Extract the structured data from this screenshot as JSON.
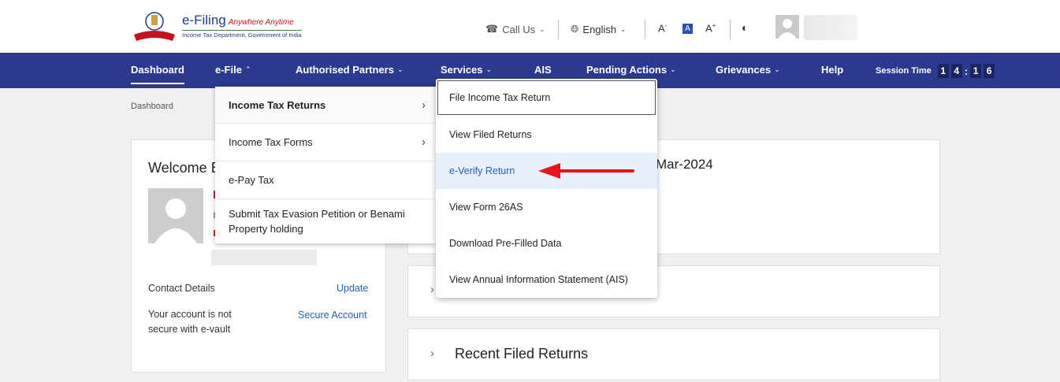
{
  "header": {
    "logo_title": "e-Filing",
    "logo_tagline": "Anywhere Anytime",
    "logo_subtitle": "Income Tax Department, Government of India",
    "call_us": "Call Us",
    "language": "English",
    "font_decrease": "A",
    "font_normal": "A",
    "font_increase": "A"
  },
  "nav": {
    "items": [
      "Dashboard",
      "e-File",
      "Authorised Partners",
      "Services",
      "AIS",
      "Pending Actions",
      "Grievances",
      "Help"
    ],
    "session_label": "Session Time",
    "session_digits": [
      "1",
      "4",
      "1",
      "6"
    ]
  },
  "breadcrumb": "Dashboard",
  "profile": {
    "welcome": "Welcome B",
    "contact_label": "Contact Details",
    "update_link": "Update",
    "vault_text_1": "Your account is not",
    "vault_text_2": "secure with e-vault",
    "secure_link": "Secure Account"
  },
  "main": {
    "due_date_fragment": "Mar-2024",
    "recent_filed": "Recent Filed Returns"
  },
  "efile_menu": [
    {
      "label": "Income Tax Returns",
      "has_sub": true
    },
    {
      "label": "Income Tax Forms",
      "has_sub": true
    },
    {
      "label": "e-Pay Tax",
      "has_sub": false
    },
    {
      "label_1": "Submit Tax Evasion Petition or Benami",
      "label_2": "Property holding",
      "has_sub": false
    }
  ],
  "itr_submenu": [
    "File Income Tax Return",
    "View Filed Returns",
    "e-Verify Return",
    "View Form 26AS",
    "Download Pre-Filled Data",
    "View Annual Information Statement (AIS)"
  ],
  "colors": {
    "nav_bg": "#2b3a8f",
    "link_blue": "#1f5dbf",
    "highlight_bg": "#e8f0fb",
    "annotation_red": "#e8141c"
  }
}
